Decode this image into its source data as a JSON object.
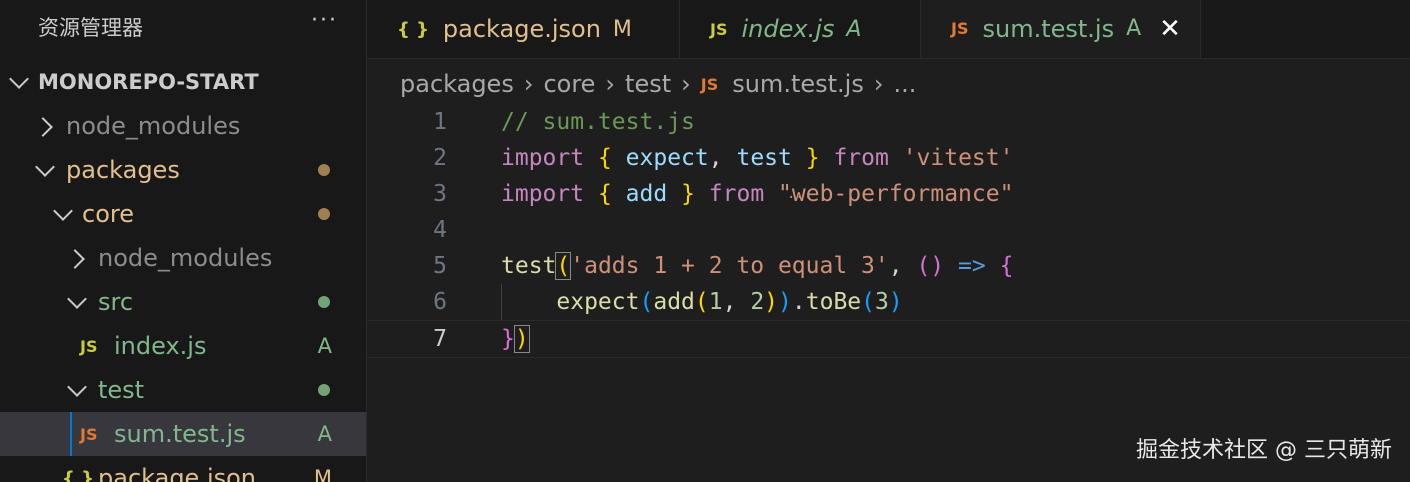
{
  "sidebar": {
    "title": "资源管理器",
    "more": "···",
    "root": "MONOREPO-START",
    "items": [
      {
        "label": "node_modules",
        "badge": ""
      },
      {
        "label": "packages",
        "badge": ""
      },
      {
        "label": "core",
        "badge": ""
      },
      {
        "label": "node_modules",
        "badge": ""
      },
      {
        "label": "src",
        "badge": ""
      },
      {
        "label": "index.js",
        "badge": "A"
      },
      {
        "label": "test",
        "badge": ""
      },
      {
        "label": "sum.test.js",
        "badge": "A"
      },
      {
        "label": "package.json",
        "badge": "M"
      }
    ],
    "file_icons": {
      "js": "JS",
      "json": "{ }"
    }
  },
  "tabs": [
    {
      "icon": "{ }",
      "name": "package.json",
      "badge": "M"
    },
    {
      "icon": "JS",
      "name": "index.js",
      "badge": "A"
    },
    {
      "icon": "JS",
      "name": "sum.test.js",
      "badge": "A",
      "close": "✕"
    }
  ],
  "breadcrumb": {
    "parts": [
      "packages",
      "core",
      "test"
    ],
    "file_icon": "JS",
    "file": "sum.test.js",
    "sep": "›",
    "more": "..."
  },
  "editor": {
    "line_numbers": [
      "1",
      "2",
      "3",
      "4",
      "5",
      "6",
      "7"
    ],
    "lines": [
      [
        {
          "t": "// sum.test.js",
          "c": "cmt"
        }
      ],
      [
        {
          "t": "import",
          "c": "kw"
        },
        {
          "t": " ",
          "c": ""
        },
        {
          "t": "{",
          "c": "br1"
        },
        {
          "t": " ",
          "c": ""
        },
        {
          "t": "expect",
          "c": "var"
        },
        {
          "t": ", ",
          "c": "op"
        },
        {
          "t": "test",
          "c": "var"
        },
        {
          "t": " ",
          "c": ""
        },
        {
          "t": "}",
          "c": "br1"
        },
        {
          "t": " ",
          "c": ""
        },
        {
          "t": "from",
          "c": "kw"
        },
        {
          "t": " ",
          "c": ""
        },
        {
          "t": "'vitest'",
          "c": "str"
        }
      ],
      [
        {
          "t": "import",
          "c": "kw"
        },
        {
          "t": " ",
          "c": ""
        },
        {
          "t": "{",
          "c": "br1"
        },
        {
          "t": " ",
          "c": ""
        },
        {
          "t": "add",
          "c": "var"
        },
        {
          "t": " ",
          "c": ""
        },
        {
          "t": "}",
          "c": "br1"
        },
        {
          "t": " ",
          "c": ""
        },
        {
          "t": "from",
          "c": "kw"
        },
        {
          "t": " ",
          "c": ""
        },
        {
          "t": "\"web-performance\"",
          "c": "str"
        }
      ],
      [],
      [
        {
          "t": "test",
          "c": "fn"
        },
        {
          "t": "(",
          "c": "br1",
          "box": true
        },
        {
          "t": "'adds 1 + 2 to equal 3'",
          "c": "str"
        },
        {
          "t": ", ",
          "c": "op"
        },
        {
          "t": "()",
          "c": "br2"
        },
        {
          "t": " ",
          "c": ""
        },
        {
          "t": "=>",
          "c": "arrow"
        },
        {
          "t": " ",
          "c": ""
        },
        {
          "t": "{",
          "c": "br2"
        }
      ],
      [
        {
          "t": "    ",
          "c": ""
        },
        {
          "t": "expect",
          "c": "fn"
        },
        {
          "t": "(",
          "c": "br3"
        },
        {
          "t": "add",
          "c": "fn"
        },
        {
          "t": "(",
          "c": "br1"
        },
        {
          "t": "1",
          "c": "num"
        },
        {
          "t": ", ",
          "c": "op"
        },
        {
          "t": "2",
          "c": "num"
        },
        {
          "t": ")",
          "c": "br1"
        },
        {
          "t": ")",
          "c": "br3"
        },
        {
          "t": ".",
          "c": "op"
        },
        {
          "t": "toBe",
          "c": "fn"
        },
        {
          "t": "(",
          "c": "br3"
        },
        {
          "t": "3",
          "c": "num"
        },
        {
          "t": ")",
          "c": "br3"
        }
      ],
      [
        {
          "t": "}",
          "c": "br2"
        },
        {
          "t": ")",
          "c": "br1",
          "box": true
        }
      ]
    ],
    "current_line": 7
  },
  "watermark": "掘金技术社区 @ 三只萌新"
}
